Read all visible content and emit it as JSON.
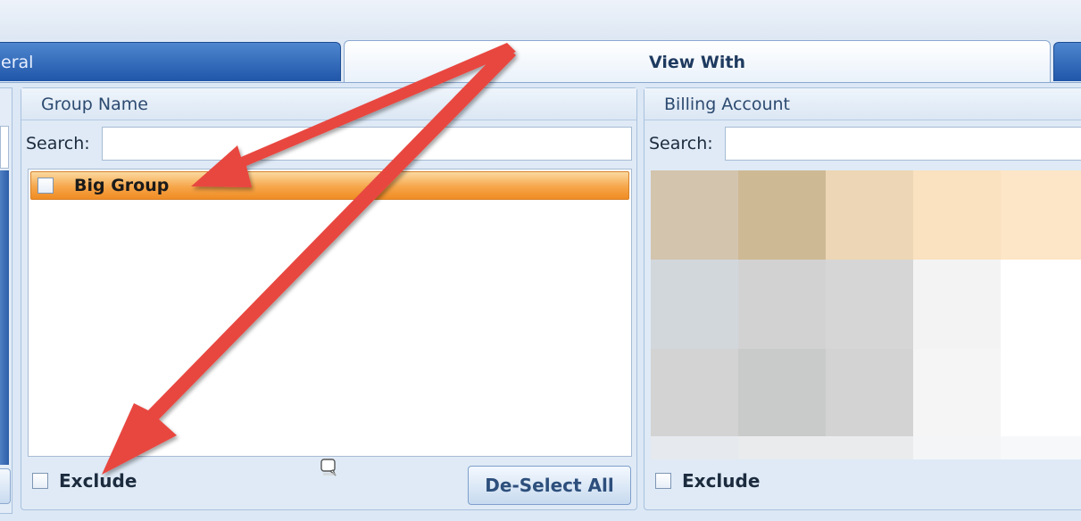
{
  "tabs": [
    {
      "label": "eral"
    },
    {
      "label": "View With"
    },
    {
      "label": ""
    }
  ],
  "group_panel": {
    "header": "Group Name",
    "search_label": "Search:",
    "search_value": "",
    "items": [
      {
        "label": "Big Group",
        "checked": false,
        "selected": true
      }
    ],
    "exclude_label": "Exclude",
    "deselect_label": "De-Select All"
  },
  "billing_panel": {
    "header": "Billing Account",
    "search_label": "Search:",
    "search_value": "",
    "exclude_label": "Exclude"
  },
  "colors": {
    "tab_active_bg": "#e9f1fa",
    "tab_inactive_bg": "#1f56a8",
    "selection_orange": "#f08c23",
    "annotation_arrow": "#e8473f"
  }
}
